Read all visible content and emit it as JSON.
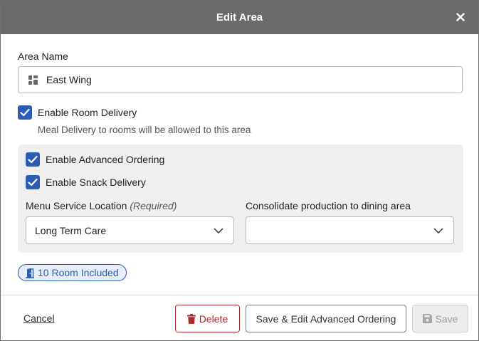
{
  "dialog": {
    "title": "Edit Area"
  },
  "form": {
    "area_name_label": "Area Name",
    "area_name_value": "East Wing",
    "enable_room_delivery_label": "Enable Room Delivery",
    "enable_room_delivery_checked": true,
    "room_delivery_helper": "Meal Delivery to rooms will be allowed to this area",
    "enable_advanced_ordering_label": "Enable Advanced Ordering",
    "enable_advanced_ordering_checked": true,
    "enable_snack_delivery_label": "Enable Snack Delivery",
    "enable_snack_delivery_checked": true,
    "menu_service_location_label": "Menu Service Location",
    "menu_service_location_required": "(Required)",
    "menu_service_location_value": "Long Term Care",
    "consolidate_label": "Consolidate production to dining area",
    "consolidate_value": "",
    "rooms_badge": "10 Room Included"
  },
  "footer": {
    "cancel_label": "Cancel",
    "delete_label": "Delete",
    "save_edit_label": "Save & Edit Advanced Ordering",
    "save_label": "Save"
  },
  "colors": {
    "titlebar": "#6a6a6a",
    "accent": "#2b5db6",
    "danger": "#b02a2a",
    "panel": "#efefef",
    "disabled": "#ececec"
  },
  "icons": {
    "close": "close-icon",
    "area": "area-grid-icon",
    "check": "check-icon",
    "chevron": "chevron-down-icon",
    "door": "door-icon",
    "trash": "trash-icon",
    "save": "floppy-disk-icon"
  }
}
